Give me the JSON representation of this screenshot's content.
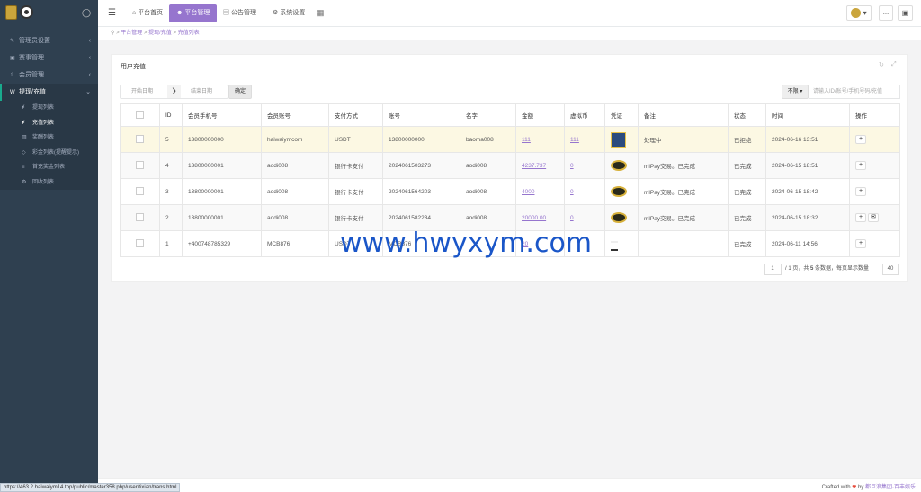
{
  "sidebar": {
    "items": [
      {
        "icon": "wrench-icon",
        "glyph": "✎",
        "label": "管理员设置"
      },
      {
        "icon": "gift-icon",
        "glyph": "▣",
        "label": "赛事管理"
      },
      {
        "icon": "user-icon",
        "glyph": "⇧",
        "label": "会员管理"
      }
    ],
    "active": {
      "icon": "w-icon",
      "glyph": "W",
      "label": "提现/充值"
    },
    "sub": [
      {
        "icon": "yen-icon",
        "glyph": "¥",
        "label": "提现列表"
      },
      {
        "icon": "yen-icon",
        "glyph": "¥",
        "label": "充值列表"
      },
      {
        "icon": "chart-icon",
        "glyph": "▥",
        "label": "奖酬列表"
      },
      {
        "icon": "diamond-icon",
        "glyph": "◇",
        "label": "彩金列表(提醒提示)"
      },
      {
        "icon": "list-icon",
        "glyph": "≡",
        "label": "首充奖金列表"
      },
      {
        "icon": "gear-icon",
        "glyph": "⚙",
        "label": "回收列表"
      }
    ]
  },
  "topbar": {
    "tabs": [
      {
        "icon": "home-icon",
        "glyph": "⌂",
        "label": "平台首页"
      },
      {
        "icon": "user-icon",
        "glyph": "☻",
        "label": "平台管理"
      },
      {
        "icon": "notice-icon",
        "glyph": "▤",
        "label": "公告管理"
      },
      {
        "icon": "gear-icon",
        "glyph": "⚙",
        "label": "系统设置"
      }
    ]
  },
  "breadcrumb": {
    "home_glyph": "⚲",
    "items": [
      "平台管理",
      "提现/充值",
      "充值列表"
    ]
  },
  "panel": {
    "title": "用户充值",
    "start_placeholder": "开始日期",
    "end_placeholder": "结束日期",
    "confirm": "确定",
    "filter": "不限",
    "search_placeholder": "请输入ID/账号/手机号码/充值"
  },
  "table": {
    "headers": [
      "",
      "ID",
      "会员手机号",
      "会员账号",
      "支付方式",
      "账号",
      "名字",
      "金额",
      "虚拟币",
      "凭证",
      "备注",
      "状态",
      "时间",
      "操作"
    ],
    "rows": [
      {
        "id": "5",
        "phone": "13800000000",
        "account": "haiwaiymcom",
        "pay": "USDT",
        "acct_no": "13800000000",
        "name": "baoma008",
        "amount": "111",
        "coin": "111",
        "proof": "square",
        "remark": "处理中",
        "status": "已拒绝",
        "time": "2024-06-16 13:51",
        "ops": [
          "+"
        ]
      },
      {
        "id": "4",
        "phone": "13800000001",
        "account": "aodi008",
        "pay": "银行卡支付",
        "acct_no": "2024061503273",
        "name": "aodi008",
        "amount": "4237.737",
        "coin": "0",
        "proof": "badge",
        "remark": "mlPay交易。已完成",
        "status": "已完成",
        "time": "2024-06-15 18:51",
        "ops": [
          "+"
        ]
      },
      {
        "id": "3",
        "phone": "13800000001",
        "account": "aodi008",
        "pay": "银行卡支付",
        "acct_no": "2024061564203",
        "name": "aodi008",
        "amount": "4000",
        "coin": "0",
        "proof": "badge",
        "remark": "mlPay交易。已完成",
        "status": "已完成",
        "time": "2024-06-15 18:42",
        "ops": [
          "+"
        ]
      },
      {
        "id": "2",
        "phone": "13800000001",
        "account": "aodi008",
        "pay": "银行卡支付",
        "acct_no": "2024061582234",
        "name": "aodi008",
        "amount": "20000.00",
        "coin": "0",
        "proof": "badge",
        "remark": "mlPay交易。已完成",
        "status": "已完成",
        "time": "2024-06-15 18:32",
        "ops": [
          "+",
          "✉"
        ]
      },
      {
        "id": "1",
        "phone": "+400748785329",
        "account": "MCB876",
        "pay": "USDT",
        "acct_no": "MCB876",
        "name": "",
        "amount": "20",
        "coin": "",
        "proof": "doc",
        "remark": "",
        "status": "已完成",
        "time": "2024-06-11 14:56",
        "ops": [
          "+"
        ]
      }
    ]
  },
  "pagination": {
    "page": "1",
    "text_pre": "/ 1 页，共",
    "total": "5",
    "text_post": "条数据，每页显示数量",
    "per_page": "40"
  },
  "footer": {
    "prefix": "Crafted with",
    "heart": "❤",
    "by": "by",
    "author": "都巨浪集团·百丰娱乐"
  },
  "status_url": "https://463.2.haiwaiym14.top/public/master358.php/user/tixian/trans.html",
  "watermark": "www.hwyxym.com"
}
